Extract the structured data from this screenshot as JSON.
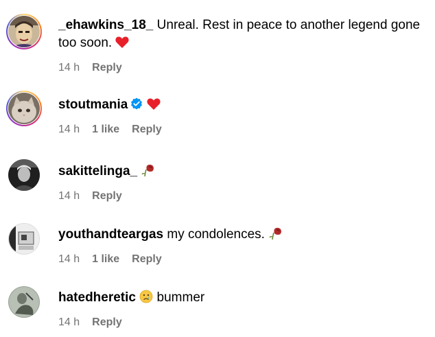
{
  "comments": [
    {
      "username": "_ehawkins_18_",
      "text": " Unreal. Rest in peace to another legend gone too soon.",
      "emoji": "red-heart",
      "time": "14 h",
      "likes": "",
      "reply": "Reply"
    },
    {
      "username": "stoutmania",
      "verified": true,
      "text": "",
      "emoji": "red-heart",
      "time": "14 h",
      "likes": "1 like",
      "reply": "Reply"
    },
    {
      "username": "sakittelinga_",
      "text": "",
      "emoji": "wilted-rose",
      "time": "14 h",
      "likes": "",
      "reply": "Reply"
    },
    {
      "username": "youthandteargas",
      "text": " my condolences.",
      "emoji": "wilted-rose",
      "time": "14 h",
      "likes": "1 like",
      "reply": "Reply"
    },
    {
      "username": "hatedheretic",
      "text": " bummer",
      "emoji": "crying-face",
      "time": "14 h",
      "likes": "",
      "reply": "Reply"
    }
  ],
  "colors": {
    "meta": "#737373",
    "verified": "#0095f6",
    "heart": "#e8202a"
  }
}
